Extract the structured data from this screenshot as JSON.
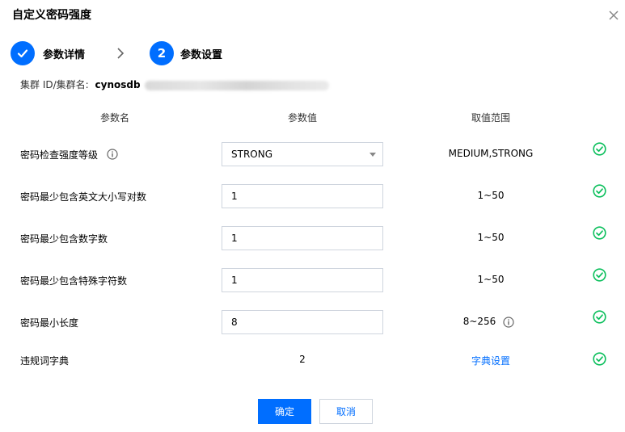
{
  "dialog": {
    "title": "自定义密码强度",
    "close_icon": "close-icon"
  },
  "steps": [
    {
      "label": "参数详情",
      "state": "done",
      "marker": "✓"
    },
    {
      "label": "参数设置",
      "state": "active",
      "marker": "2"
    }
  ],
  "cluster": {
    "label": "集群 ID/集群名:",
    "id_prefix": "cynosdb"
  },
  "table": {
    "headers": [
      "参数名",
      "参数值",
      "取值范围"
    ],
    "rows": [
      {
        "name": "密码检查强度等级",
        "has_info": true,
        "control": "select",
        "value": "STRONG",
        "range": "MEDIUM,STRONG",
        "range_has_info": false,
        "valid": true
      },
      {
        "name": "密码最少包含英文大小写对数",
        "has_info": false,
        "control": "input",
        "value": "1",
        "range": "1~50",
        "range_has_info": false,
        "valid": true
      },
      {
        "name": "密码最少包含数字数",
        "has_info": false,
        "control": "input",
        "value": "1",
        "range": "1~50",
        "range_has_info": false,
        "valid": true
      },
      {
        "name": "密码最少包含特殊字符数",
        "has_info": false,
        "control": "input",
        "value": "1",
        "range": "1~50",
        "range_has_info": false,
        "valid": true
      },
      {
        "name": "密码最小长度",
        "has_info": false,
        "control": "input",
        "value": "8",
        "range": "8~256",
        "range_has_info": true,
        "valid": true
      },
      {
        "name": "违规词字典",
        "has_info": false,
        "control": "static",
        "value": "2",
        "range": "字典设置",
        "range_is_link": true,
        "valid": true
      }
    ]
  },
  "footer": {
    "confirm_label": "确定",
    "cancel_label": "取消"
  },
  "colors": {
    "primary": "#006eff",
    "success": "#0abf5b",
    "border": "#cfd5de"
  }
}
